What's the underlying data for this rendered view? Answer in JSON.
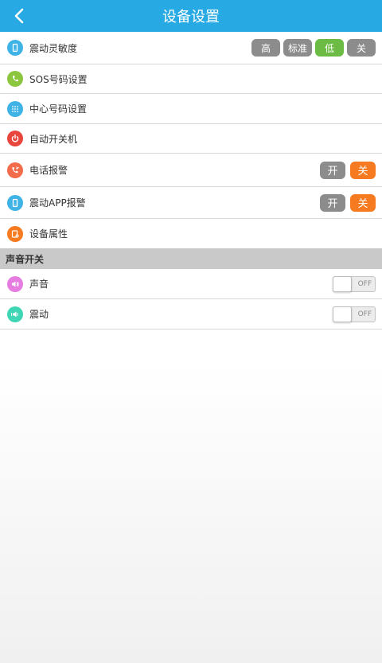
{
  "header": {
    "title": "设备设置",
    "back_icon": "chevron-left-icon"
  },
  "colors": {
    "header_bg": "#27a9e3",
    "seg_inactive": "#8c8c8c",
    "seg_active_green": "#6cbb45",
    "onoff_active_orange": "#f57a20"
  },
  "settings": {
    "vibration_sensitivity": {
      "label": "震动灵敏度",
      "icon": "phone-icon",
      "options": [
        "高",
        "标准",
        "低",
        "关"
      ],
      "selected": "低"
    },
    "sos": {
      "label": "SOS号码设置",
      "icon": "phone-call-icon"
    },
    "center_number": {
      "label": "中心号码设置",
      "icon": "keypad-icon"
    },
    "auto_power": {
      "label": "自动开关机",
      "icon": "power-icon"
    },
    "phone_alarm": {
      "label": "电话报警",
      "icon": "phone-alarm-icon",
      "on_label": "开",
      "off_label": "关",
      "selected": "关"
    },
    "app_alarm": {
      "label": "震动APP报警",
      "icon": "phone-icon",
      "on_label": "开",
      "off_label": "关",
      "selected": "关"
    },
    "device_properties": {
      "label": "设备属性",
      "icon": "device-properties-icon"
    }
  },
  "sound_section": {
    "title": "声音开关",
    "sound": {
      "label": "声音",
      "icon": "speaker-icon",
      "state": "OFF"
    },
    "vibrate": {
      "label": "震动",
      "icon": "vibrate-icon",
      "state": "OFF"
    }
  }
}
